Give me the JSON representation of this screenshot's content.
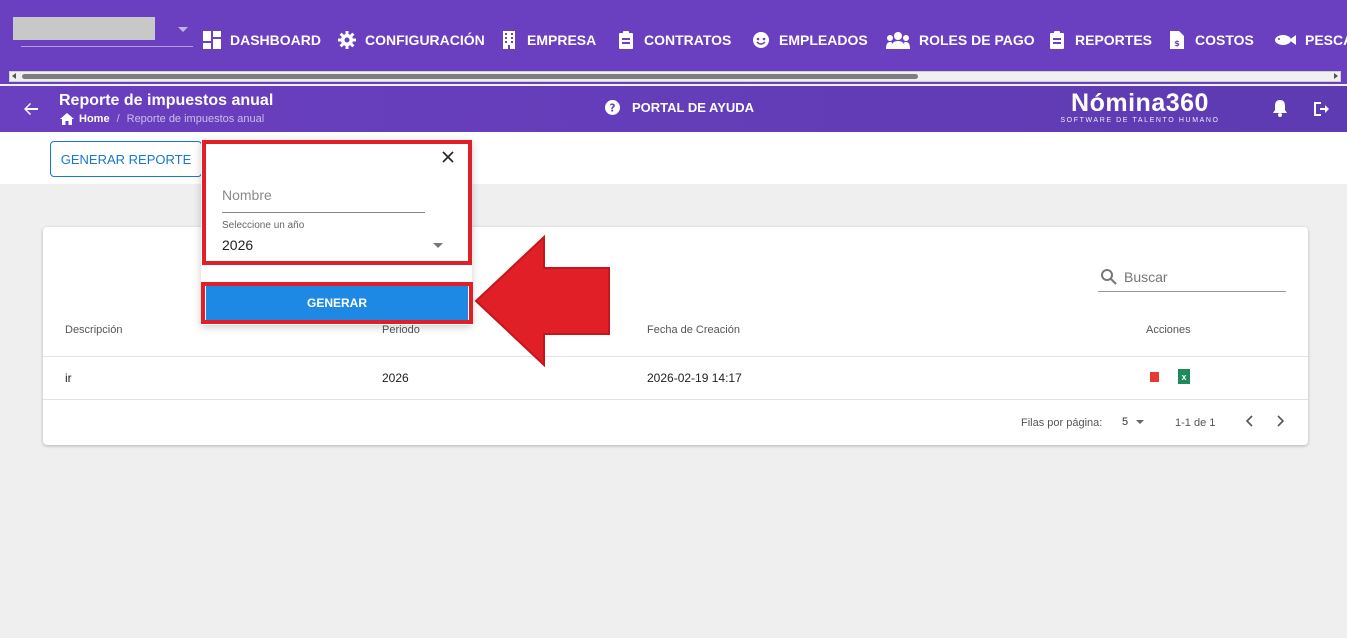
{
  "nav": {
    "items": [
      {
        "label": "DASHBOARD",
        "icon": "dashboard-icon"
      },
      {
        "label": "CONFIGURACIÓN",
        "icon": "gear-icon"
      },
      {
        "label": "EMPRESA",
        "icon": "building-icon"
      },
      {
        "label": "CONTRATOS",
        "icon": "clipboard-icon"
      },
      {
        "label": "EMPLEADOS",
        "icon": "face-icon"
      },
      {
        "label": "ROLES DE PAGO",
        "icon": "group-icon"
      },
      {
        "label": "REPORTES",
        "icon": "report-icon"
      },
      {
        "label": "COSTOS",
        "icon": "file-dollar-icon"
      },
      {
        "label": "PESCA",
        "icon": "fish-icon"
      }
    ]
  },
  "header": {
    "title": "Reporte de impuestos anual",
    "breadcrumb_home": "Home",
    "breadcrumb_sep": "/",
    "breadcrumb_current": "Reporte de impuestos anual",
    "help_label": "PORTAL DE AYUDA",
    "logo_main": "Nómina360",
    "logo_sub": "SOFTWARE DE TALENTO HUMANO"
  },
  "toolbar": {
    "generate_report_label": "GENERAR REPORTE"
  },
  "dialog": {
    "name_placeholder": "Nombre",
    "year_label": "Seleccione un año",
    "year_value": "2026",
    "submit_label": "GENERAR"
  },
  "table": {
    "search_placeholder": "Buscar",
    "columns": [
      "Descripción",
      "Periodo",
      "Fecha de Creación",
      "Acciones"
    ],
    "rows": [
      {
        "descripcion": "ir",
        "periodo": "2026",
        "fecha": "2026-02-19 14:17"
      }
    ],
    "rows_per_page_label": "Filas por página:",
    "rows_per_page": "5",
    "range": "1-1 de 1"
  },
  "colors": {
    "brand_purple": "#6a3fc0",
    "primary_blue": "#1e88e5",
    "annotation_red": "#e01f26"
  }
}
